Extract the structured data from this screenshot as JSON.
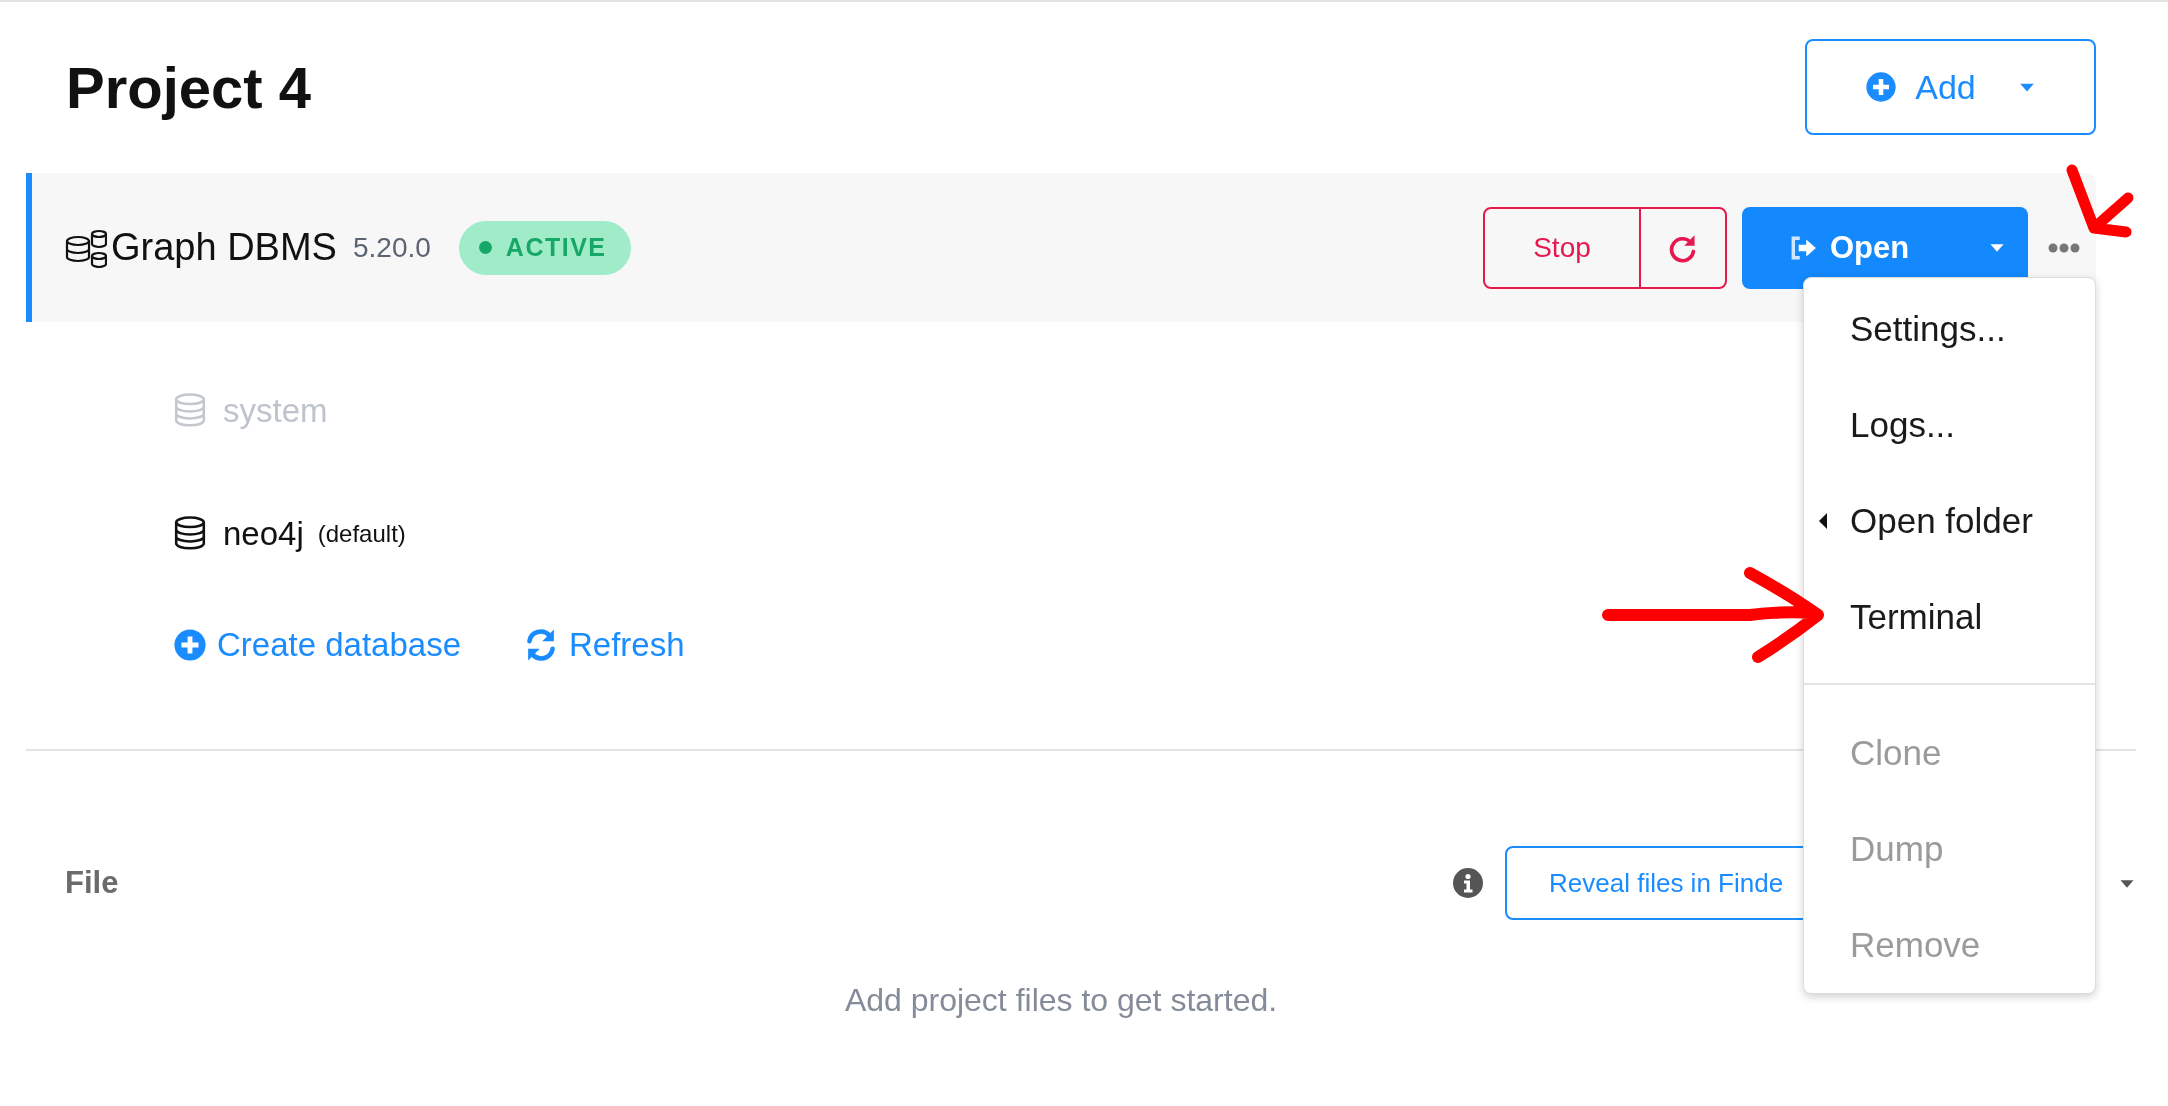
{
  "project": {
    "title": "Project 4",
    "add_button": "Add"
  },
  "dbms": {
    "name": "Graph DBMS",
    "version": "5.20.0",
    "status": "ACTIVE",
    "selected": true,
    "stop_button": "Stop",
    "open_button": "Open"
  },
  "databases": [
    {
      "name": "system",
      "disabled": true
    },
    {
      "name": "neo4j",
      "tag": "(default)",
      "disabled": false
    }
  ],
  "database_actions": [
    {
      "kind": "create",
      "label": "Create database"
    },
    {
      "kind": "refresh",
      "label": "Refresh"
    }
  ],
  "menu": {
    "groups": [
      [
        {
          "label": "Settings...",
          "disabled": false
        },
        {
          "label": "Logs...",
          "disabled": false
        },
        {
          "label": "Open folder",
          "disabled": false,
          "submenu": true
        },
        {
          "label": "Terminal",
          "disabled": false
        }
      ],
      [
        {
          "label": "Clone",
          "disabled": true
        },
        {
          "label": "Dump",
          "disabled": true
        },
        {
          "label": "Remove",
          "disabled": true
        }
      ]
    ]
  },
  "files": {
    "title": "File",
    "reveal_button": "Reveal files in Finde",
    "empty_message": "Add project files to get started."
  },
  "annotations": [
    {
      "kind": "hook-arrow"
    },
    {
      "kind": "arrow"
    }
  ]
}
